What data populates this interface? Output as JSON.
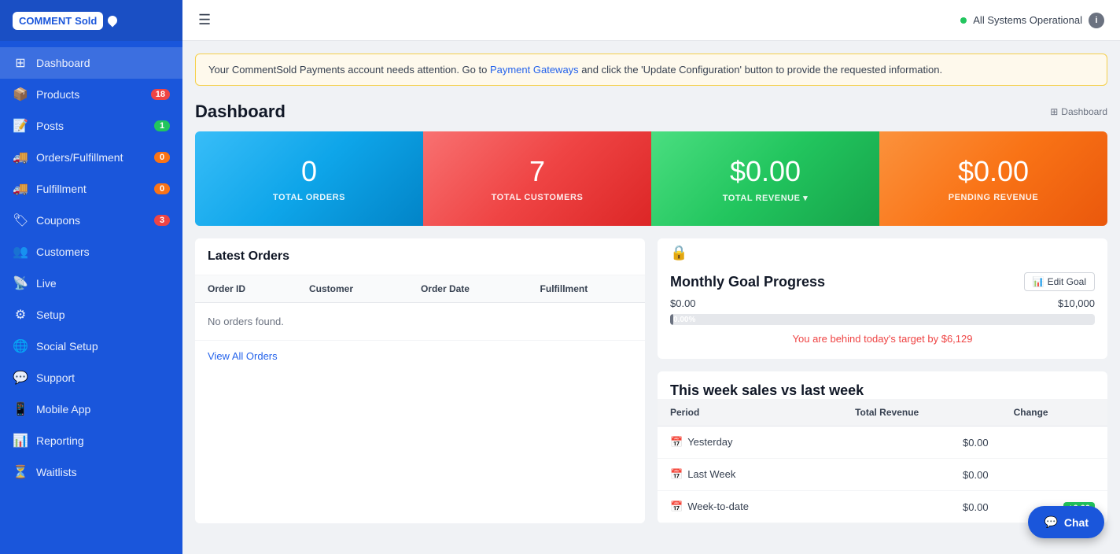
{
  "sidebar": {
    "logo": {
      "comment": "COMMENT",
      "sold": "Sold"
    },
    "items": [
      {
        "id": "dashboard",
        "label": "Dashboard",
        "icon": "⊞",
        "badge": null,
        "badgeColor": null,
        "active": true
      },
      {
        "id": "products",
        "label": "Products",
        "icon": "📦",
        "badge": "18",
        "badgeColor": "red",
        "active": false
      },
      {
        "id": "posts",
        "label": "Posts",
        "icon": "📝",
        "badge": "1",
        "badgeColor": "green",
        "active": false
      },
      {
        "id": "orders-fulfillment",
        "label": "Orders/Fulfillment",
        "icon": "🚚",
        "badge": "0",
        "badgeColor": "orange",
        "active": false
      },
      {
        "id": "fulfillment",
        "label": "Fulfillment",
        "icon": "🚚",
        "badge": "0",
        "badgeColor": "orange",
        "active": false
      },
      {
        "id": "coupons",
        "label": "Coupons",
        "icon": "🏷",
        "badge": "3",
        "badgeColor": "red",
        "active": false
      },
      {
        "id": "customers",
        "label": "Customers",
        "icon": "👥",
        "badge": null,
        "badgeColor": null,
        "active": false
      },
      {
        "id": "live",
        "label": "Live",
        "icon": "📡",
        "badge": null,
        "badgeColor": null,
        "active": false
      },
      {
        "id": "setup",
        "label": "Setup",
        "icon": "⚙",
        "badge": null,
        "badgeColor": null,
        "active": false
      },
      {
        "id": "social-setup",
        "label": "Social Setup",
        "icon": "🌐",
        "badge": null,
        "badgeColor": null,
        "active": false
      },
      {
        "id": "support",
        "label": "Support",
        "icon": "💬",
        "badge": null,
        "badgeColor": null,
        "active": false
      },
      {
        "id": "mobile-app",
        "label": "Mobile App",
        "icon": "📱",
        "badge": null,
        "badgeColor": null,
        "active": false
      },
      {
        "id": "reporting",
        "label": "Reporting",
        "icon": "📊",
        "badge": null,
        "badgeColor": null,
        "active": false
      },
      {
        "id": "waitlists",
        "label": "Waitlists",
        "icon": "⏳",
        "badge": null,
        "badgeColor": null,
        "active": false
      }
    ]
  },
  "topbar": {
    "hamburger_label": "☰",
    "status_text": "All Systems Operational",
    "info_label": "i"
  },
  "alert": {
    "text_before": "Your CommentSold Payments account needs attention. Go to ",
    "link_text": "Payment Gateways",
    "text_after": " and click the 'Update Configuration' button to provide the requested information."
  },
  "page": {
    "title": "Dashboard",
    "breadcrumb_icon": "⊞",
    "breadcrumb_label": "Dashboard"
  },
  "stats": [
    {
      "id": "total-orders",
      "value": "0",
      "label": "TOTAL ORDERS",
      "color": "blue"
    },
    {
      "id": "total-customers",
      "value": "7",
      "label": "TOTAL CUSTOMERS",
      "color": "red"
    },
    {
      "id": "total-revenue",
      "value": "$0.00",
      "label": "TOTAL REVENUE",
      "color": "green",
      "dropdown": true
    },
    {
      "id": "pending-revenue",
      "value": "$0.00",
      "label": "PENDING REVENUE",
      "color": "orange"
    }
  ],
  "latest_orders": {
    "title": "Latest Orders",
    "columns": [
      "Order ID",
      "Customer",
      "Order Date",
      "Fulfillment"
    ],
    "no_orders_text": "No orders found.",
    "view_all_label": "View All Orders"
  },
  "monthly_goal": {
    "title": "Monthly Goal Progress",
    "edit_btn_label": "Edit Goal",
    "current": "$0.00",
    "target": "$10,000",
    "progress_pct": "0.00%",
    "progress_value": 0,
    "behind_text": "You are behind today's target by $6,129"
  },
  "weekly_sales": {
    "title": "This week sales vs last week",
    "columns": [
      "Period",
      "Total Revenue",
      "Change"
    ],
    "rows": [
      {
        "period": "Yesterday",
        "revenue": "$0.00",
        "change": null
      },
      {
        "period": "Last Week",
        "revenue": "$0.00",
        "change": null
      },
      {
        "period": "Week-to-date",
        "revenue": "$0.00",
        "change": "+0.00",
        "change_positive": true
      }
    ]
  },
  "chat_btn": {
    "label": "Chat",
    "icon": "💬"
  }
}
